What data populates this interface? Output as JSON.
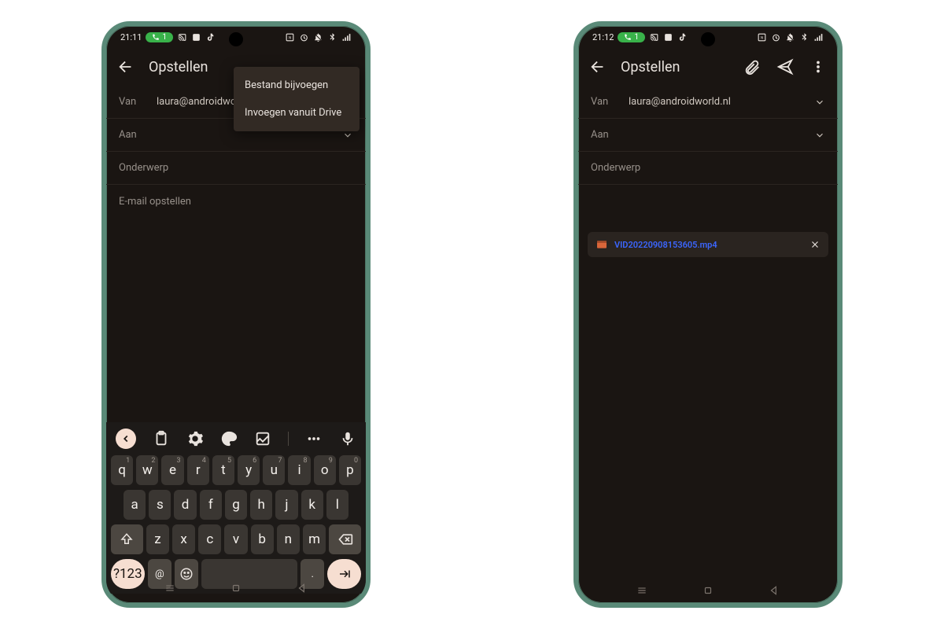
{
  "status_left": {
    "time_a": "21:11",
    "time_b": "21:12",
    "badge": "1"
  },
  "appbar": {
    "title": "Opstellen"
  },
  "menu": {
    "item1": "Bestand bijvoegen",
    "item2": "Invoegen vanuit Drive"
  },
  "fields": {
    "from_label": "Van",
    "from_value": "laura@androidworld.nl",
    "to_label": "Aan",
    "subject_placeholder": "Onderwerp",
    "body_placeholder": "E-mail opstellen"
  },
  "attachment": {
    "name": "VID20220908153605.mp4"
  },
  "keyboard": {
    "row1": [
      [
        "q",
        "1"
      ],
      [
        "w",
        "2"
      ],
      [
        "e",
        "3"
      ],
      [
        "r",
        "4"
      ],
      [
        "t",
        "5"
      ],
      [
        "y",
        "6"
      ],
      [
        "u",
        "7"
      ],
      [
        "i",
        "8"
      ],
      [
        "o",
        "9"
      ],
      [
        "p",
        "0"
      ]
    ],
    "row2": [
      "a",
      "s",
      "d",
      "f",
      "g",
      "h",
      "j",
      "k",
      "l"
    ],
    "row3": [
      "z",
      "x",
      "c",
      "v",
      "b",
      "n",
      "m"
    ],
    "sym": "?123",
    "at": "@",
    "period": "."
  }
}
